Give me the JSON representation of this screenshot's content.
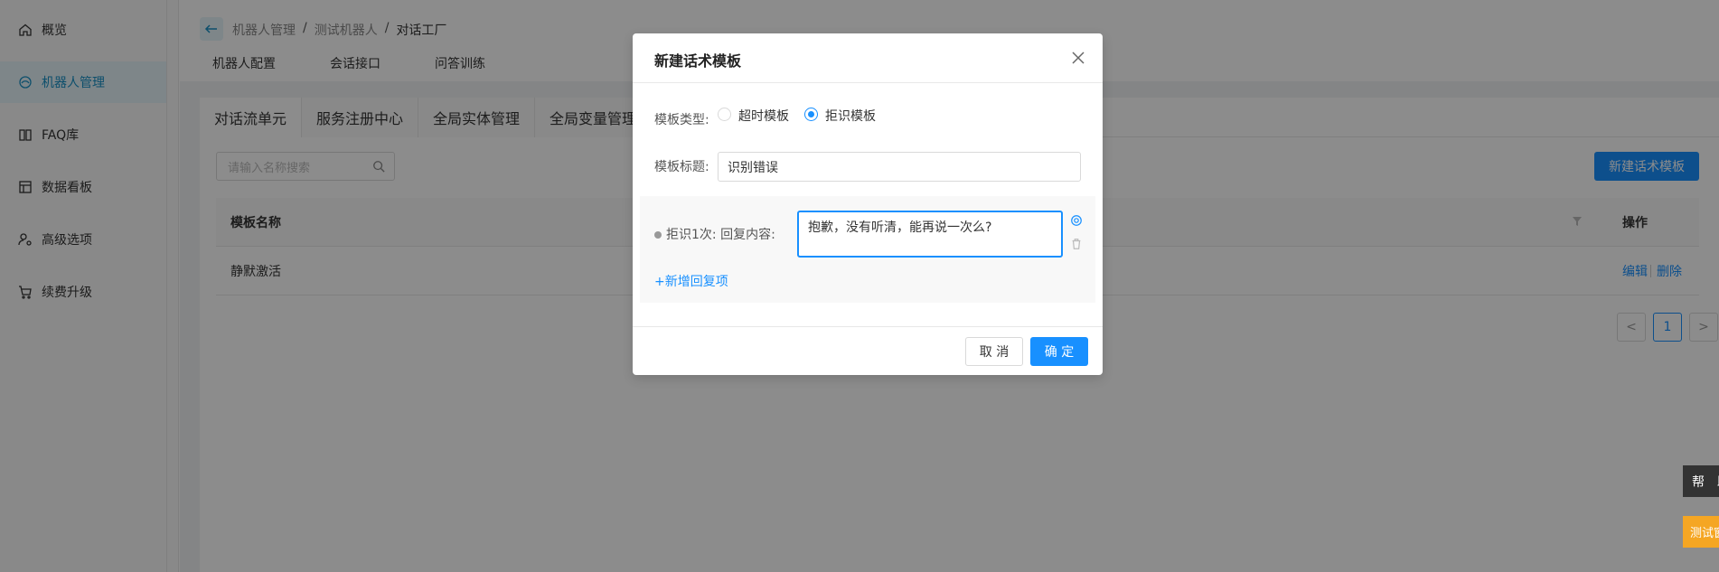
{
  "sidebar": {
    "items": [
      {
        "label": "概览",
        "icon": "home-icon"
      },
      {
        "label": "机器人管理",
        "icon": "robot-icon"
      },
      {
        "label": "FAQ库",
        "icon": "book-icon"
      },
      {
        "label": "数据看板",
        "icon": "dashboard-icon"
      },
      {
        "label": "高级选项",
        "icon": "user-settings-icon"
      },
      {
        "label": "续费升级",
        "icon": "cart-icon"
      }
    ]
  },
  "breadcrumb": {
    "items": [
      "机器人管理",
      "测试机器人",
      "对话工厂"
    ],
    "separator": "/"
  },
  "top_tabs": [
    "机器人配置",
    "会话接口",
    "问答训练"
  ],
  "sub_tabs": [
    "对话流单元",
    "服务注册中心",
    "全局实体管理",
    "全局变量管理"
  ],
  "search": {
    "placeholder": "请输入名称搜索"
  },
  "new_template_button": "新建话术模板",
  "table": {
    "col_name": "模板名称",
    "col_ops": "操作",
    "rows": [
      {
        "name": "静默激活",
        "edit": "编辑",
        "delete": "删除"
      }
    ]
  },
  "pagination": {
    "prev": "<",
    "current": "1",
    "next": ">"
  },
  "float": {
    "help": "帮助",
    "test": "测试窗"
  },
  "modal": {
    "title": "新建话术模板",
    "type_label": "模板类型:",
    "type_options": [
      "超时模板",
      "拒识模板"
    ],
    "type_selected": "拒识模板",
    "title_label": "模板标题:",
    "title_value": "识别错误",
    "reply_label": "拒识1次: 回复内容:",
    "reply_value": "抱歉，没有听清，能再说一次么?",
    "add_reply": "+新增回复项",
    "cancel": "取 消",
    "confirm": "确 定"
  },
  "colors": {
    "primary": "#1890ff",
    "accent": "#f5a623"
  }
}
